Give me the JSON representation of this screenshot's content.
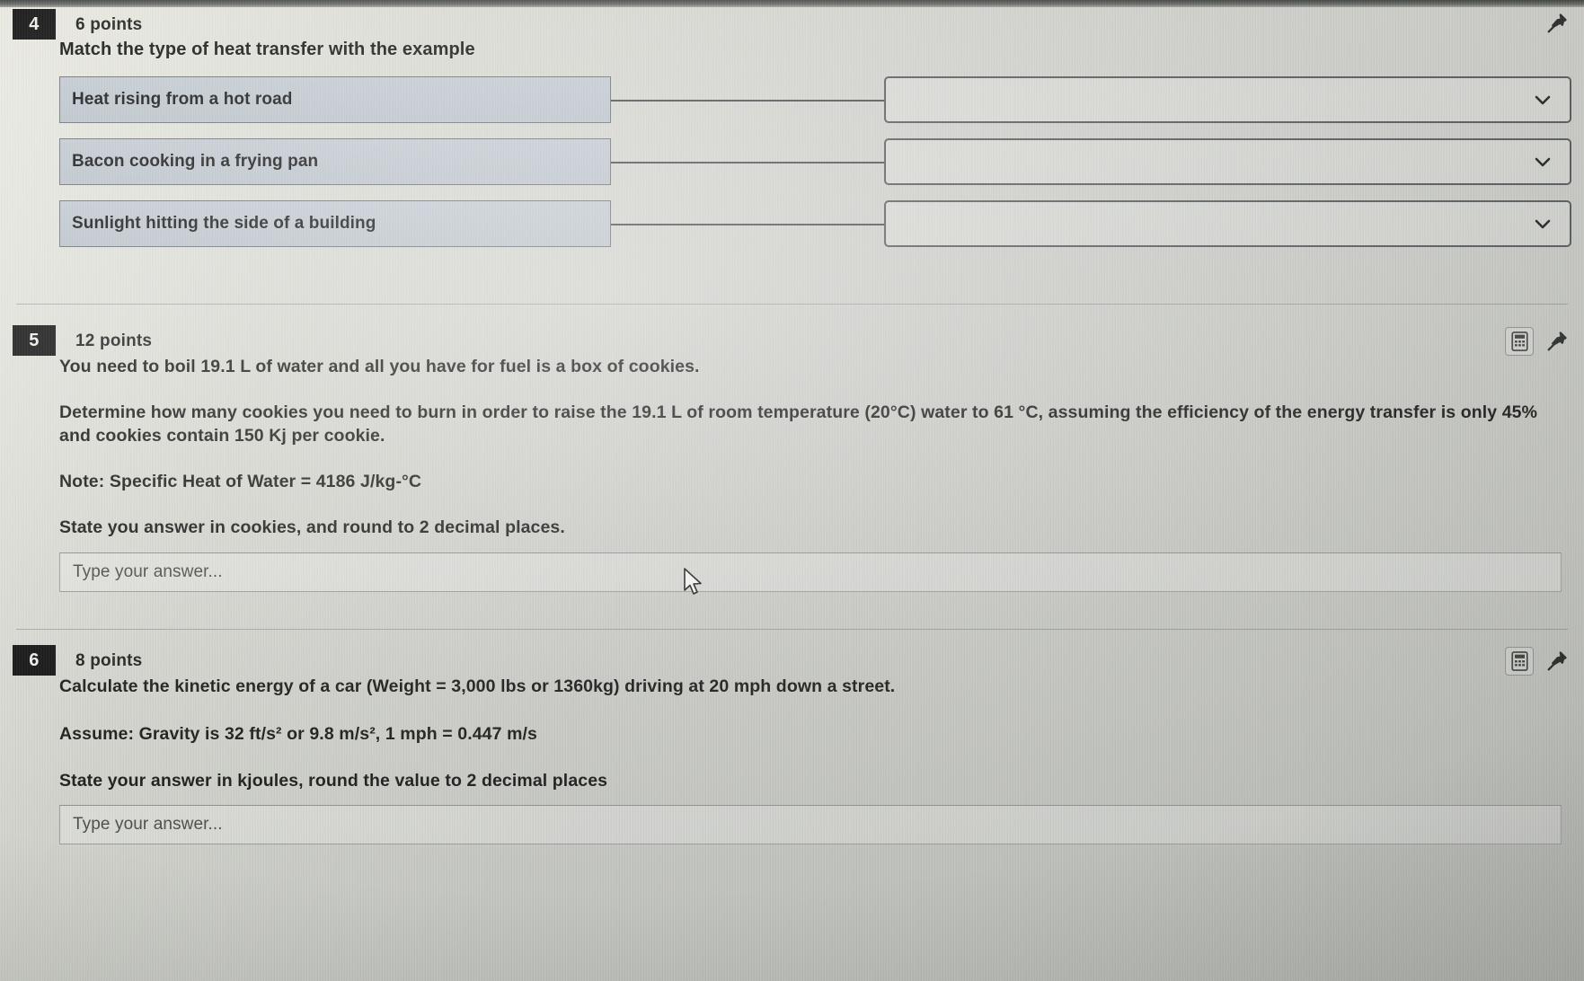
{
  "questions": [
    {
      "number": "4",
      "points": "6 points",
      "prompt": "Match the type of heat transfer with the example",
      "type": "matching",
      "has_calculator": false,
      "pin_label": "pin-question",
      "pairs": [
        {
          "left": "Heat rising from a hot road",
          "right_value": ""
        },
        {
          "left": "Bacon cooking in a frying pan",
          "right_value": ""
        },
        {
          "left": "Sunlight hitting the side of a building",
          "right_value": ""
        }
      ]
    },
    {
      "number": "5",
      "points": "12 points",
      "type": "short-answer",
      "has_calculator": true,
      "paragraphs": [
        "You need to boil 19.1 L of water and all you have for fuel is a box of cookies.",
        "Determine how many cookies you need to burn in order to raise the 19.1 L of room temperature (20°C) water to 61 °C, assuming the efficiency of the energy transfer is only 45% and cookies contain 150 Kj per cookie.",
        "Note: Specific Heat of Water = 4186 J/kg-°C",
        "State you answer in cookies, and round to 2 decimal places."
      ],
      "answer_placeholder": "Type your answer...",
      "answer_value": ""
    },
    {
      "number": "6",
      "points": "8 points",
      "type": "short-answer",
      "has_calculator": true,
      "paragraphs": [
        "Calculate the kinetic energy of a car (Weight = 3,000 lbs or 1360kg) driving at 20 mph down a street.",
        "Assume: Gravity is 32 ft/s² or 9.8 m/s², 1 mph = 0.447 m/s",
        "State your answer in kjoules, round the value to 2 decimal places"
      ],
      "answer_placeholder": "Type your answer...",
      "answer_value": ""
    }
  ],
  "colors": {
    "question_number_bg": "#131313",
    "question_number_text": "#efeee9",
    "match_left_bg": "#c0c8cf",
    "border": "#55585a",
    "page_bg": "#cbccc7"
  }
}
